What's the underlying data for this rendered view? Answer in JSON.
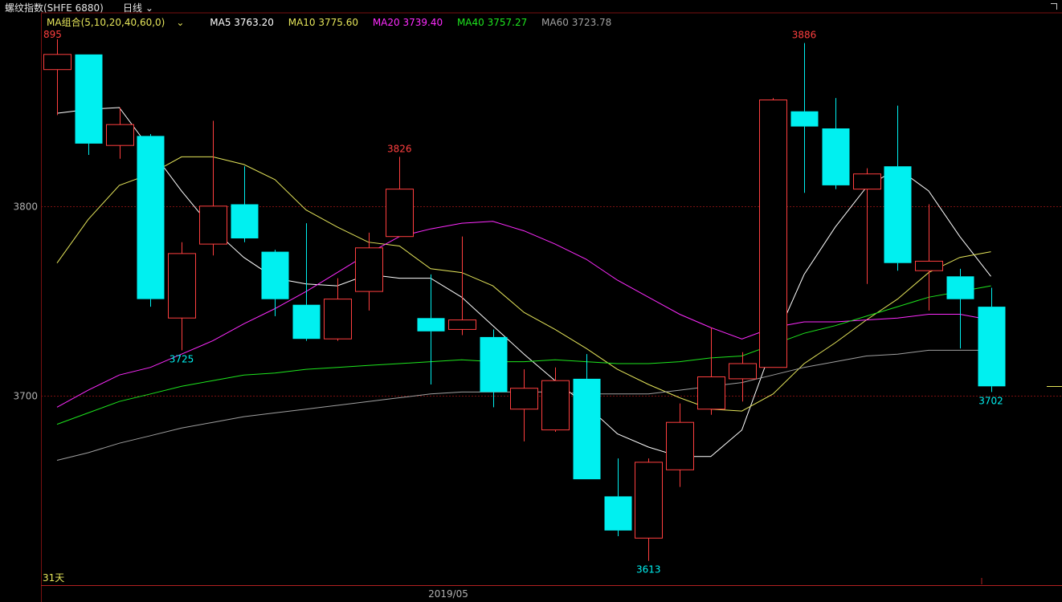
{
  "header": {
    "symbol": "螺纹指数(SHFE 6880)",
    "period": "日线",
    "period_icon": "chevron-down-icon"
  },
  "legend": {
    "group": "MA组合(5,10,20,40,60,0)",
    "ma5": "MA5 3763.20",
    "ma10": "MA10 3775.60",
    "ma20": "MA20 3739.40",
    "ma40": "MA40 3757.27",
    "ma60": "MA60 3723.78"
  },
  "colors": {
    "up": "#ff3f3f",
    "down": "#00f0f0",
    "ma5": "#ffffff",
    "ma10": "#e5e55a",
    "ma20": "#ff2bff",
    "ma40": "#1ee61e",
    "ma60": "#a0a0a0",
    "grid": "#7a1010"
  },
  "chart_data": {
    "type": "candlestick",
    "ylim": [
      3604,
      3896
    ],
    "yticks": [
      3700,
      3800
    ],
    "xtick": "2019/05",
    "days_label": "31天",
    "top_left_label": "895",
    "candles": [
      {
        "o": 3872,
        "c": 3880,
        "h": 3888,
        "l": 3848
      },
      {
        "o": 3880,
        "c": 3833,
        "h": 3880,
        "l": 3827
      },
      {
        "o": 3832,
        "c": 3843,
        "h": 3852,
        "l": 3825
      },
      {
        "o": 3837,
        "c": 3751,
        "h": 3838,
        "l": 3747
      },
      {
        "o": 3741,
        "c": 3775,
        "h": 3781,
        "l": 3724
      },
      {
        "o": 3780,
        "c": 3800,
        "h": 3845,
        "l": 3774
      },
      {
        "o": 3801,
        "c": 3783,
        "h": 3821,
        "l": 3781
      },
      {
        "o": 3776,
        "c": 3751,
        "h": 3777,
        "l": 3742
      },
      {
        "o": 3748,
        "c": 3730,
        "h": 3791,
        "l": 3729
      },
      {
        "o": 3730,
        "c": 3751,
        "h": 3762,
        "l": 3729
      },
      {
        "o": 3755,
        "c": 3778,
        "h": 3786,
        "l": 3745
      },
      {
        "o": 3784,
        "c": 3809,
        "h": 3826,
        "l": 3784
      },
      {
        "o": 3741,
        "c": 3734,
        "h": 3764,
        "l": 3706
      },
      {
        "o": 3735,
        "c": 3740,
        "h": 3784,
        "l": 3732
      },
      {
        "o": 3731,
        "c": 3702,
        "h": 3735,
        "l": 3694
      },
      {
        "o": 3693,
        "c": 3704,
        "h": 3714,
        "l": 3676
      },
      {
        "o": 3682,
        "c": 3708,
        "h": 3715,
        "l": 3681
      },
      {
        "o": 3709,
        "c": 3656,
        "h": 3722,
        "l": 3656
      },
      {
        "o": 3647,
        "c": 3629,
        "h": 3667,
        "l": 3626
      },
      {
        "o": 3625,
        "c": 3665,
        "h": 3667,
        "l": 3613
      },
      {
        "o": 3661,
        "c": 3686,
        "h": 3696,
        "l": 3652
      },
      {
        "o": 3693,
        "c": 3710,
        "h": 3736,
        "l": 3690
      },
      {
        "o": 3709,
        "c": 3717,
        "h": 3723,
        "l": 3697
      },
      {
        "o": 3715,
        "c": 3856,
        "h": 3857,
        "l": 3715
      },
      {
        "o": 3850,
        "c": 3842,
        "h": 3886,
        "l": 3807
      },
      {
        "o": 3841,
        "c": 3811,
        "h": 3857,
        "l": 3809
      },
      {
        "o": 3809,
        "c": 3817,
        "h": 3820,
        "l": 3759
      },
      {
        "o": 3821,
        "c": 3770,
        "h": 3853,
        "l": 3766
      },
      {
        "o": 3766,
        "c": 3771,
        "h": 3801,
        "l": 3745
      },
      {
        "o": 3763,
        "c": 3751,
        "h": 3767,
        "l": 3725
      },
      {
        "o": 3747,
        "c": 3705,
        "h": 3757,
        "l": 3702
      }
    ],
    "series": [
      {
        "name": "MA5",
        "values": [
          3849,
          3851,
          3852,
          3830,
          3808,
          3788,
          3773,
          3762,
          3759,
          3758,
          3764,
          3762,
          3762,
          3752,
          3737,
          3722,
          3708,
          3695,
          3680,
          3673,
          3668,
          3668,
          3682,
          3727,
          3764,
          3789,
          3810,
          3820,
          3808,
          3784,
          3763
        ]
      },
      {
        "name": "MA10",
        "values": [
          3770,
          3793,
          3811,
          3817,
          3826,
          3826,
          3822,
          3814,
          3798,
          3789,
          3781,
          3779,
          3767,
          3765,
          3758,
          3744,
          3735,
          3725,
          3714,
          3706,
          3699,
          3693,
          3692,
          3701,
          3717,
          3728,
          3740,
          3751,
          3765,
          3773,
          3776
        ]
      },
      {
        "name": "MA20",
        "values": [
          3694,
          3703,
          3711,
          3715,
          3722,
          3729,
          3738,
          3746,
          3755,
          3765,
          3775,
          3784,
          3788,
          3791,
          3792,
          3787,
          3780,
          3772,
          3761,
          3752,
          3743,
          3736,
          3730,
          3736,
          3739,
          3739,
          3740,
          3741,
          3743,
          3743,
          3740
        ]
      },
      {
        "name": "MA40",
        "values": [
          3685,
          3691,
          3697,
          3701,
          3705,
          3708,
          3711,
          3712,
          3714,
          3715,
          3716,
          3717,
          3718,
          3719,
          3718,
          3718,
          3719,
          3718,
          3717,
          3717,
          3718,
          3720,
          3721,
          3727,
          3733,
          3737,
          3742,
          3747,
          3752,
          3755,
          3758
        ]
      },
      {
        "name": "MA60",
        "values": [
          3666,
          3670,
          3675,
          3679,
          3683,
          3686,
          3689,
          3691,
          3693,
          3695,
          3697,
          3699,
          3701,
          3702,
          3702,
          3702,
          3702,
          3701,
          3701,
          3701,
          3703,
          3705,
          3707,
          3711,
          3715,
          3718,
          3721,
          3722,
          3724,
          3724,
          3724
        ]
      }
    ],
    "labels": [
      {
        "idx": 11,
        "pos": "high",
        "text": "3826",
        "color": "up"
      },
      {
        "idx": 24,
        "pos": "high",
        "text": "3886",
        "color": "up"
      },
      {
        "idx": 4,
        "pos": "low",
        "text": "3725",
        "color": "down"
      },
      {
        "idx": 19,
        "pos": "low",
        "text": "3613",
        "color": "down"
      },
      {
        "idx": 30,
        "pos": "low",
        "text": "3702",
        "color": "down"
      }
    ],
    "current_price": 3705
  }
}
